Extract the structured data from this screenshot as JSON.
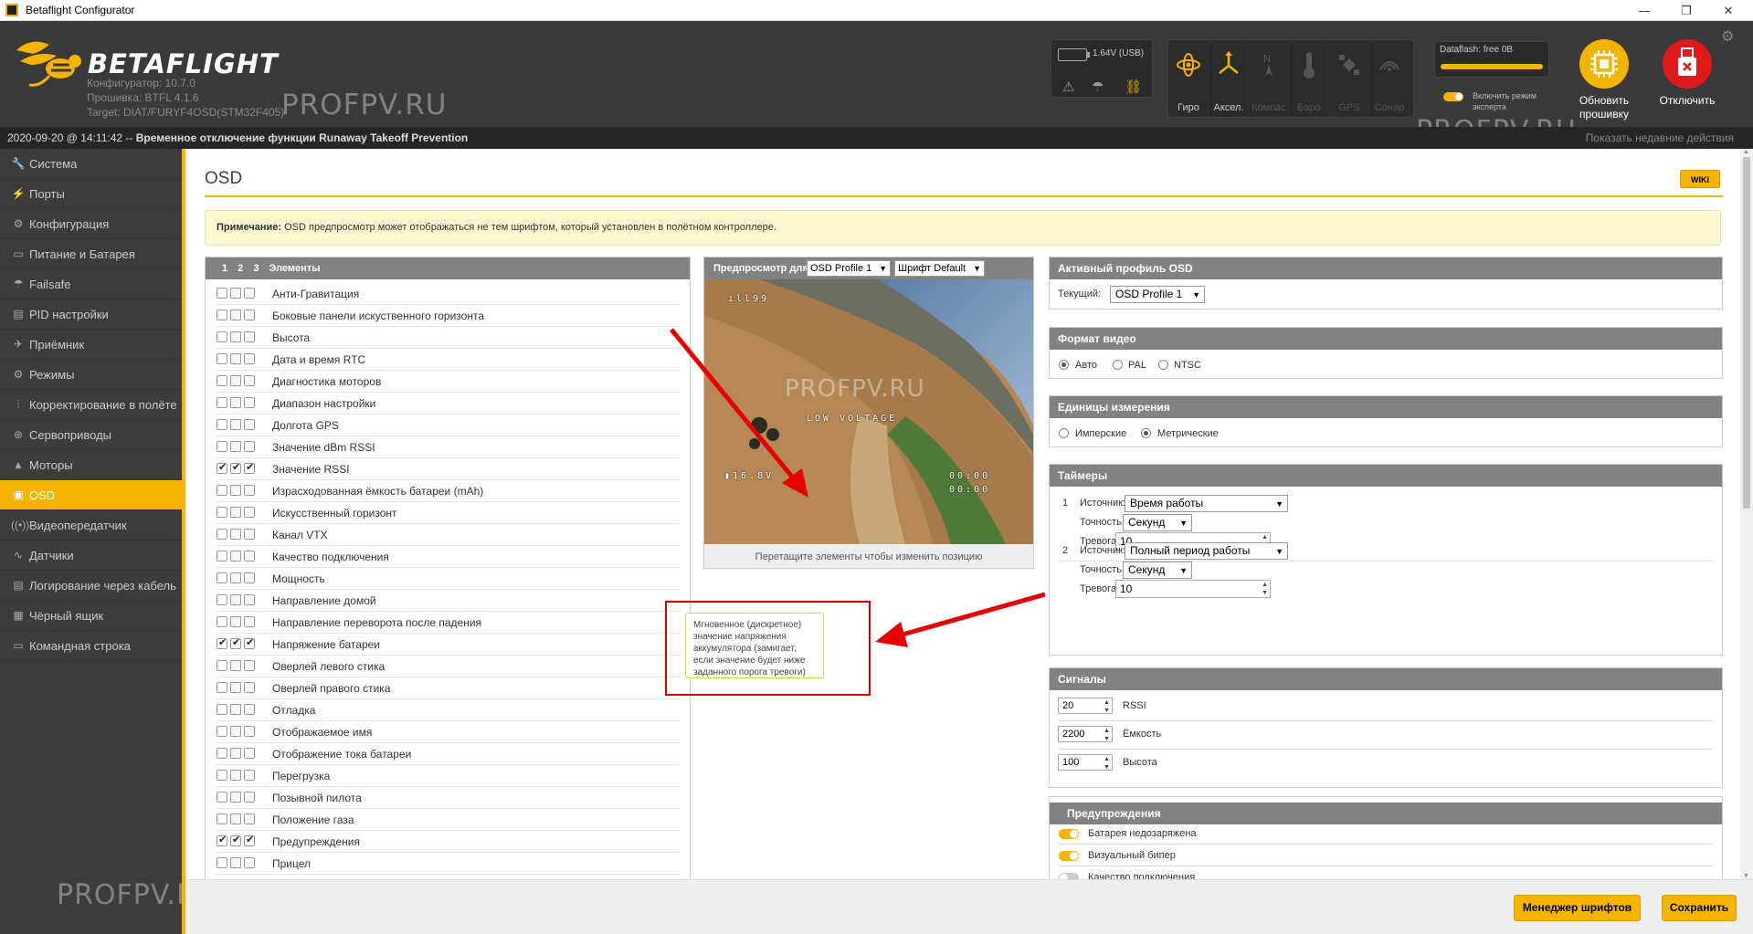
{
  "window": {
    "title": "Betaflight Configurator",
    "controls": [
      "—",
      "❐",
      "✕"
    ]
  },
  "header": {
    "brand": "BETAFLIGHT",
    "configurator": "Конфигуратор: 10.7.0",
    "firmware": "Прошивка: BTFL 4.1.6",
    "target": "Target: DIAT/FURYF4OSD(STM32F405)",
    "watermark": "PROFPV.RU",
    "battery_voltage": "1.64V (USB)",
    "sensors": [
      {
        "label": "Гиро",
        "icon": "gyro-icon",
        "active": true
      },
      {
        "label": "Аксел.",
        "icon": "accelerometer-icon",
        "active": true
      },
      {
        "label": "Компас",
        "icon": "compass-icon",
        "active": false
      },
      {
        "label": "Баро",
        "icon": "barometer-icon",
        "active": false
      },
      {
        "label": "GPS",
        "icon": "gps-icon",
        "active": false
      },
      {
        "label": "Сонар",
        "icon": "sonar-icon",
        "active": false
      }
    ],
    "dataflash": "Dataflash: free 0B",
    "expert_mode": "Включить режим эксперта",
    "flash_button": "Обновить прошивку",
    "disconnect_button": "Отключить"
  },
  "status": {
    "timestamp": "2020-09-20 @ 14:11:42",
    "separator": " -- ",
    "message": "Временное отключение функции Runaway Takeoff Prevention",
    "show_log": "Показать недавние действия"
  },
  "sidebar": {
    "items": [
      {
        "label": "Система",
        "icon": "wrench-icon"
      },
      {
        "label": "Порты",
        "icon": "plug-icon"
      },
      {
        "label": "Конфигурация",
        "icon": "gear-icon"
      },
      {
        "label": "Питание и Батарея",
        "icon": "battery-icon"
      },
      {
        "label": "Failsafe",
        "icon": "parachute-icon"
      },
      {
        "label": "PID настройки",
        "icon": "pid-icon"
      },
      {
        "label": "Приёмник",
        "icon": "receiver-icon"
      },
      {
        "label": "Режимы",
        "icon": "modes-icon"
      },
      {
        "label": "Корректирование в полёте",
        "icon": "sliders-icon"
      },
      {
        "label": "Сервоприводы",
        "icon": "servo-icon"
      },
      {
        "label": "Моторы",
        "icon": "motor-icon"
      },
      {
        "label": "OSD",
        "icon": "osd-icon"
      },
      {
        "label": "Видеопередатчик",
        "icon": "vtx-icon"
      },
      {
        "label": "Датчики",
        "icon": "sensors-icon"
      },
      {
        "label": "Логирование через кабель",
        "icon": "log-icon"
      },
      {
        "label": "Чёрный ящик",
        "icon": "blackbox-icon"
      },
      {
        "label": "Командная строка",
        "icon": "terminal-icon"
      }
    ],
    "active": "OSD"
  },
  "main": {
    "title": "OSD",
    "wiki": "WIKI",
    "note_label": "Примечание:",
    "note_text": " OSD предпросмотр может отображаться не тем шрифтом, который установлен в полётном контроллере.",
    "elements_header": "1 2 3 Элементы",
    "elements": [
      {
        "name": "Анти-Гравитация",
        "checks": [
          false,
          false,
          false
        ]
      },
      {
        "name": "Боковые панели искуственного горизонта",
        "checks": [
          false,
          false,
          false
        ]
      },
      {
        "name": "Высота",
        "checks": [
          false,
          false,
          false
        ]
      },
      {
        "name": "Дата и время RTC",
        "checks": [
          false,
          false,
          false
        ]
      },
      {
        "name": "Диагностика моторов",
        "checks": [
          false,
          false,
          false
        ]
      },
      {
        "name": "Диапазон настройки",
        "checks": [
          false,
          false,
          false
        ]
      },
      {
        "name": "Долгота GPS",
        "checks": [
          false,
          false,
          false
        ]
      },
      {
        "name": "Значение dBm RSSI",
        "checks": [
          false,
          false,
          false
        ]
      },
      {
        "name": "Значение RSSI",
        "checks": [
          true,
          true,
          true
        ]
      },
      {
        "name": "Израсходованная ёмкость батареи (mAh)",
        "checks": [
          false,
          false,
          false
        ]
      },
      {
        "name": "Искусственный горизонт",
        "checks": [
          false,
          false,
          false
        ]
      },
      {
        "name": "Канал VTX",
        "checks": [
          false,
          false,
          false
        ]
      },
      {
        "name": "Качество подключения",
        "checks": [
          false,
          false,
          false
        ]
      },
      {
        "name": "Мощность",
        "checks": [
          false,
          false,
          false
        ]
      },
      {
        "name": "Направление домой",
        "checks": [
          false,
          false,
          false
        ]
      },
      {
        "name": "Направление переворота после падения",
        "checks": [
          false,
          false,
          false
        ]
      },
      {
        "name": "Напряжение батареи",
        "checks": [
          true,
          true,
          true
        ]
      },
      {
        "name": "Оверлей левого стика",
        "checks": [
          false,
          false,
          false
        ]
      },
      {
        "name": "Оверлей правого стика",
        "checks": [
          false,
          false,
          false
        ]
      },
      {
        "name": "Отладка",
        "checks": [
          false,
          false,
          false
        ]
      },
      {
        "name": "Отображаемое имя",
        "checks": [
          false,
          false,
          false
        ]
      },
      {
        "name": "Отображение тока батареи",
        "checks": [
          false,
          false,
          false
        ]
      },
      {
        "name": "Перегрузка",
        "checks": [
          false,
          false,
          false
        ]
      },
      {
        "name": "Позывной пилота",
        "checks": [
          false,
          false,
          false
        ]
      },
      {
        "name": "Положение газа",
        "checks": [
          false,
          false,
          false
        ]
      },
      {
        "name": "Предупреждения",
        "checks": [
          true,
          true,
          true
        ]
      },
      {
        "name": "Прицел",
        "checks": [
          false,
          false,
          false
        ]
      }
    ],
    "preview": {
      "label": "Предпросмотр для",
      "profile": "OSD Profile 1",
      "font": "Шрифт Default",
      "footer": "Перетащите элементы чтобы изменить позицию",
      "osd_rssi": "99",
      "osd_warning": "LOW VOLTAGE",
      "osd_voltage": "16.8V",
      "osd_timer1": "00:00",
      "osd_timer2": "00:00"
    },
    "tooltip": "Мгновенное (дискретное) значение напряжения аккумулятора (замигает, если значение будет ниже заданного порога тревоги)",
    "active_profile": {
      "title": "Активный профиль OSD",
      "current_label": "Текущий:",
      "current_value": "OSD Profile 1"
    },
    "video_format": {
      "title": "Формат видео",
      "options": [
        "Авто",
        "PAL",
        "NTSC"
      ],
      "selected": "Авто"
    },
    "units": {
      "title": "Единицы измерения",
      "options": [
        "Имперские",
        "Метрические"
      ],
      "selected": "Метрические"
    },
    "timers": {
      "title": "Таймеры",
      "source_label": "Источник:",
      "precision_label": "Точность:",
      "alarm_label": "Тревога:",
      "items": [
        {
          "num": "1",
          "source": "Время работы",
          "precision": "Секунд",
          "alarm": "10"
        },
        {
          "num": "2",
          "source": "Полный период работы",
          "precision": "Секунд",
          "alarm": "10"
        }
      ]
    },
    "alarms": {
      "title": "Сигналы",
      "items": [
        {
          "value": "20",
          "label": "RSSI"
        },
        {
          "value": "2200",
          "label": "Ёмкость"
        },
        {
          "value": "100",
          "label": "Высота"
        }
      ]
    },
    "warnings": {
      "title": "Предупреждения",
      "items": [
        {
          "label": "Батарея недозаряжена",
          "on": true
        },
        {
          "label": "Визуальный бипер",
          "on": true
        },
        {
          "label": "Качество подключения",
          "on": false
        }
      ]
    }
  },
  "footer": {
    "font_manager": "Менеджер шрифтов",
    "save": "Сохранить"
  },
  "colors": {
    "accent": "#f5b400",
    "header_bg": "#3a3a3a",
    "sidebar_bg": "#3c3c3c",
    "annotation_red": "#dd0000"
  }
}
